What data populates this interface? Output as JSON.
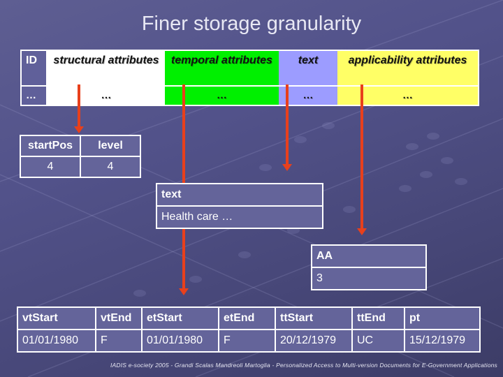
{
  "slide": {
    "title": "Finer storage granularity",
    "footer": "IADIS e-society 2005 - Grandi Scalas Mandreoli Martoglia - Personalized Access to Multi-version Documents for E-Government Applications"
  },
  "record_table": {
    "headers": [
      "ID",
      "structural attributes",
      "temporal attributes",
      "text",
      "applicability attributes"
    ],
    "values": [
      "…",
      "…",
      "…",
      "…",
      "…"
    ],
    "colors": {
      "id": "#60609a",
      "structural": "#ffffff",
      "temporal": "#00f000",
      "text": "#9c9cff",
      "applicability": "#ffff66"
    }
  },
  "structural_table": {
    "headers": [
      "startPos",
      "level"
    ],
    "values": [
      "4",
      "4"
    ]
  },
  "text_table": {
    "header": "text",
    "value": "Health care …"
  },
  "applicability_table": {
    "header": "AA",
    "value": "3"
  },
  "temporal_table": {
    "headers": [
      "vtStart",
      "vtEnd",
      "etStart",
      "etEnd",
      "ttStart",
      "ttEnd",
      "pt"
    ],
    "values": [
      "01/01/1980",
      "F",
      "01/01/1980",
      "F",
      "20/12/1979",
      "UC",
      "15/12/1979"
    ]
  },
  "arrow_color": "#e8401c"
}
